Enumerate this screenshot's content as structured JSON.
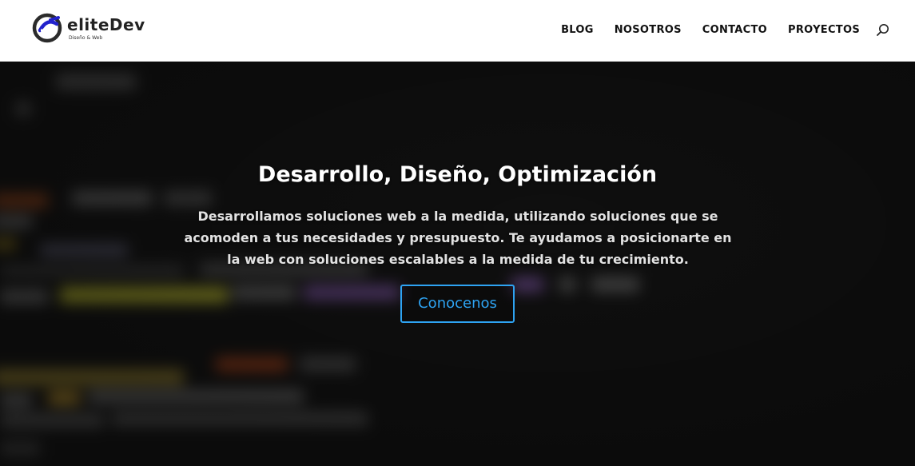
{
  "header": {
    "brand": {
      "name": "eliteDev",
      "tagline": "Diseño & Web",
      "logo_icon": "elitedev-logo-icon",
      "accent_color": "#2222cc"
    },
    "nav": {
      "items": [
        {
          "label": "BLOG"
        },
        {
          "label": "NOSOTROS"
        },
        {
          "label": "CONTACTO"
        },
        {
          "label": "PROYECTOS"
        }
      ],
      "search_icon": "search-icon"
    }
  },
  "hero": {
    "title": "Desarrollo, Diseño, Optimización",
    "text": "Desarrollamos soluciones web a la medida, utilizando soluciones que se acomoden a tus necesidades y presupuesto. Te ayudamos a posicionarte en la web con soluciones escalables a la medida de tu crecimiento.",
    "cta": {
      "label": "Conocenos",
      "color": "#2ea3f2"
    },
    "background": "blurred-code-screen"
  }
}
